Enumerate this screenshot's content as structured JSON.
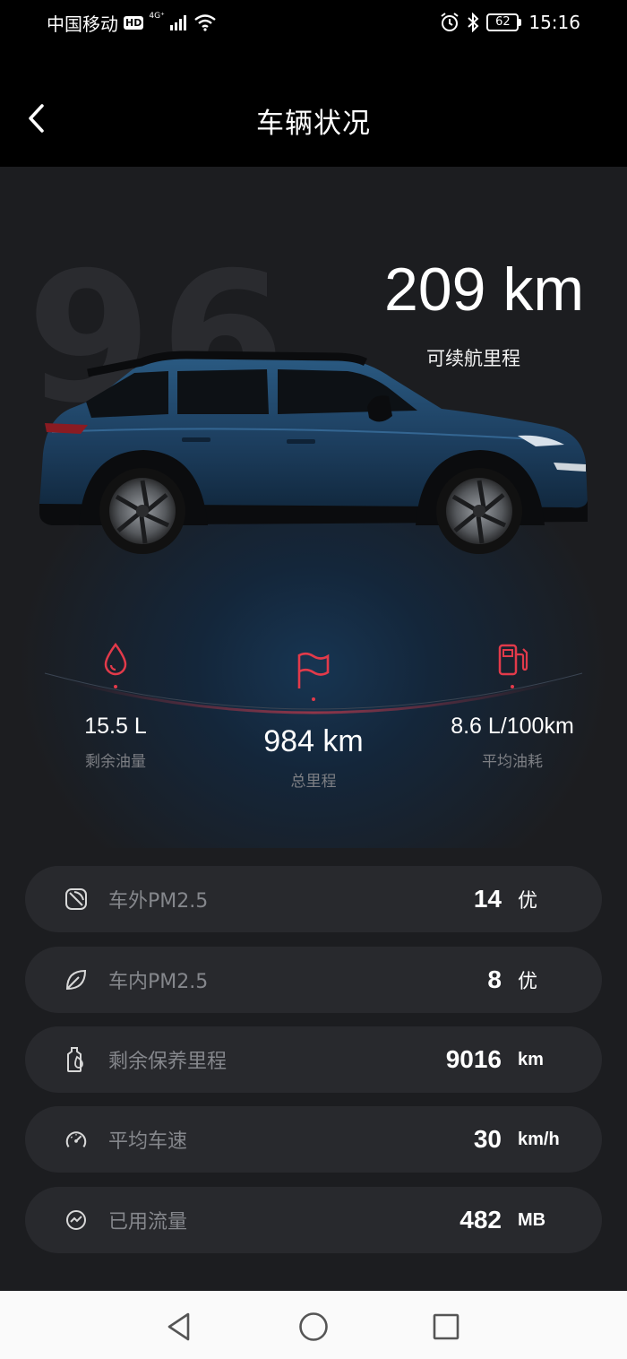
{
  "status_bar": {
    "carrier": "中国移动",
    "hd": "HD",
    "network": "4G⁺",
    "battery": "62",
    "time": "15:16"
  },
  "header": {
    "title": "车辆状况"
  },
  "hero": {
    "watermark": "96",
    "range_value": "209 km",
    "range_label": "可续航里程"
  },
  "stats": [
    {
      "icon": "fuel-drop-icon",
      "value": "15.5 L",
      "label": "剩余油量"
    },
    {
      "icon": "flag-icon",
      "value": "984 km",
      "label": "总里程"
    },
    {
      "icon": "fuel-pump-icon",
      "value": "8.6 L/100km",
      "label": "平均油耗"
    }
  ],
  "rows": [
    {
      "icon": "outdoor-leaf-icon",
      "label": "车外PM2.5",
      "value": "14",
      "unit": "优"
    },
    {
      "icon": "indoor-leaf-icon",
      "label": "车内PM2.5",
      "value": "8",
      "unit": "优"
    },
    {
      "icon": "oil-bottle-icon",
      "label": "剩余保养里程",
      "value": "9016",
      "unit": "km"
    },
    {
      "icon": "speedometer-icon",
      "label": "平均车速",
      "value": "30",
      "unit": "km/h"
    },
    {
      "icon": "data-traffic-icon",
      "label": "已用流量",
      "value": "482",
      "unit": "MB"
    }
  ],
  "colors": {
    "accent": "#e23a4a",
    "background": "#1c1d20",
    "row_background": "#28292d",
    "car_body": "#1d3f60"
  }
}
